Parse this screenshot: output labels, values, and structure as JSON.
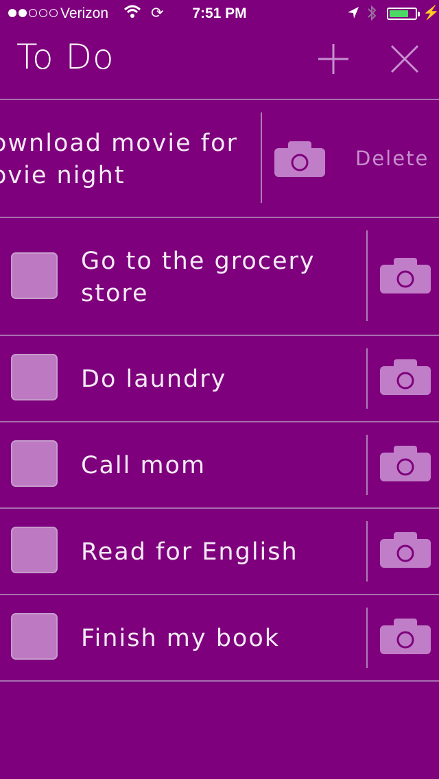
{
  "status_bar": {
    "carrier": "Verizon",
    "time": "7:51 PM",
    "signal_bars_filled": 2,
    "signal_bars_total": 5,
    "battery_level": 0.75,
    "icons": [
      "wifi-icon",
      "sync-icon",
      "location-arrow-icon",
      "bluetooth-icon",
      "battery-icon",
      "charging-bolt-icon"
    ]
  },
  "nav": {
    "title": "To Do",
    "add_icon": "plus-icon",
    "close_icon": "close-icon"
  },
  "swiped_item": {
    "text": "ownload movie for\novie night",
    "delete_label": "Delete"
  },
  "tasks": [
    {
      "text": "Go to the grocery\nstore",
      "checked": false
    },
    {
      "text": "Do laundry",
      "checked": false
    },
    {
      "text": "Call mom",
      "checked": false
    },
    {
      "text": "Read for English",
      "checked": false
    },
    {
      "text": "Finish my book",
      "checked": false
    }
  ],
  "colors": {
    "background": "#7e007c",
    "checkbox": "#bd79c2",
    "divider": "#a86fb0",
    "camera": "#c17ec8",
    "battery": "#4cd964"
  }
}
